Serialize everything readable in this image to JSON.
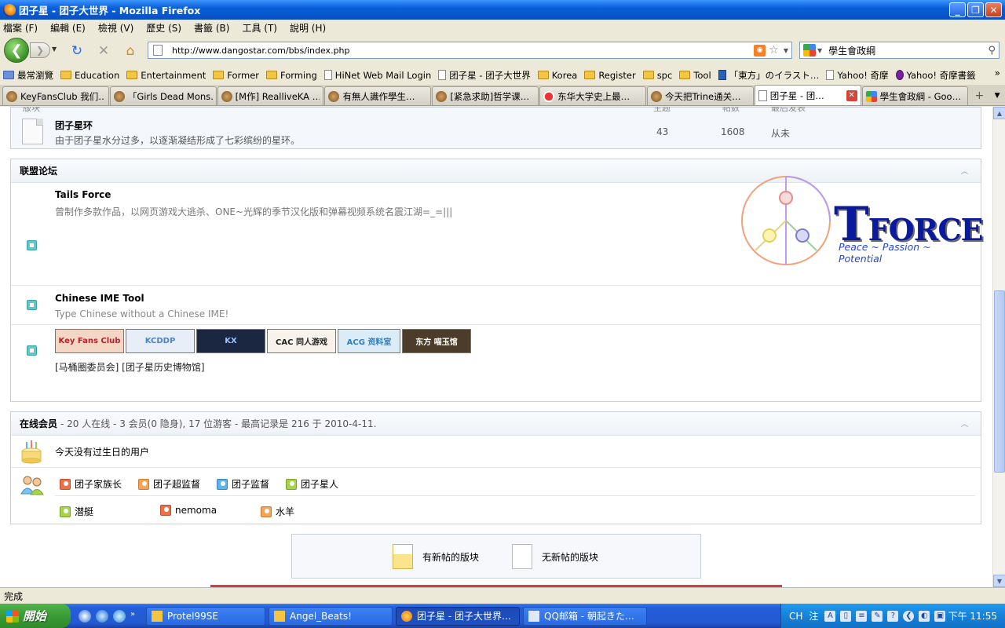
{
  "window": {
    "title": "团子星 - 团子大世界 - Mozilla Firefox",
    "buttons": {
      "minimize": "_",
      "maximize": "❐",
      "close": "✕"
    }
  },
  "menu": [
    "檔案 (F)",
    "編輯 (E)",
    "檢視 (V)",
    "歷史 (S)",
    "書籤 (B)",
    "工具 (T)",
    "說明 (H)"
  ],
  "nav": {
    "url": "http://www.dangostar.com/bbs/index.php",
    "search_value": "學生會政綱"
  },
  "bookmarks": [
    {
      "label": "最常瀏覽",
      "icon": "folder"
    },
    {
      "label": "Education",
      "icon": "folder"
    },
    {
      "label": "Entertainment",
      "icon": "folder"
    },
    {
      "label": "Former",
      "icon": "folder"
    },
    {
      "label": "Forming",
      "icon": "folder"
    },
    {
      "label": "HiNet Web Mail Login",
      "icon": "page"
    },
    {
      "label": "团子星 - 团子大世界",
      "icon": "page"
    },
    {
      "label": "Korea",
      "icon": "folder"
    },
    {
      "label": "Register",
      "icon": "folder"
    },
    {
      "label": "spc",
      "icon": "folder"
    },
    {
      "label": "Tool",
      "icon": "folder"
    },
    {
      "label": "「東方」のイラスト…",
      "icon": "pixiv"
    },
    {
      "label": "Yahoo! 奇摩",
      "icon": "page"
    },
    {
      "label": "Yahoo! 奇摩書籤",
      "icon": "yahoo"
    }
  ],
  "tabs": [
    {
      "label": "KeyFansClub 我们…",
      "icon": "avatar"
    },
    {
      "label": "「Girls Dead Mons…",
      "icon": "avatar"
    },
    {
      "label": "[M作] RealliveKA …",
      "icon": "avatar"
    },
    {
      "label": "有無人識作學生…",
      "icon": "avatar"
    },
    {
      "label": "[紧急求助]哲学课…",
      "icon": "avatar"
    },
    {
      "label": "东华大学史上最…",
      "icon": "yt"
    },
    {
      "label": "今天把Trine通关…",
      "icon": "avatar"
    },
    {
      "label": "团子星 - 团…",
      "icon": "page",
      "active": true
    },
    {
      "label": "學生會政綱 - Goo…",
      "icon": "g"
    }
  ],
  "content": {
    "top_cut": [
      "版块",
      "主题",
      "帖数",
      "最后发表"
    ],
    "forum": {
      "title": "团子星环",
      "desc": "由于团子星水分过多，以逐渐凝结形成了七彩缤纷的星环。",
      "topics": "43",
      "posts": "1608",
      "last": "从未"
    },
    "alliance": {
      "header": "联盟论坛",
      "items": [
        {
          "title": "Tails Force",
          "desc": "曾制作多款作品，以网页游戏大逃杀、ONE~光辉的季节汉化版和弹幕视频系统名震江湖=_=|||"
        },
        {
          "title": "Chinese IME Tool",
          "desc": "Type Chinese without a Chinese IME!"
        }
      ],
      "tforce_logo": {
        "word_big": "T",
        "word_rest": "FORCE",
        "tagline": "Peace ~ Passion ~ Potential"
      },
      "banners": [
        {
          "text": "Key Fans Club",
          "bg": "#f3d7c4",
          "color": "#b3222a",
          "w": 88
        },
        {
          "text": "KCDDP",
          "bg": "#e8eef8",
          "color": "#4a83c4",
          "w": 88
        },
        {
          "text": "KX",
          "bg": "#1b2740",
          "color": "#9fc3ff",
          "w": 88
        },
        {
          "text": "CAC 同人游戏",
          "bg": "#f7f2ea",
          "color": "#222",
          "w": 88
        },
        {
          "text": "ACG 资料室",
          "bg": "#dcecf7",
          "color": "#2f7fc1",
          "w": 80
        },
        {
          "text": "东方 喵玉馆",
          "bg": "#4c3c2a",
          "color": "#fff",
          "w": 88
        }
      ],
      "text_links": "[马桶圈委员会] [团子星历史博物馆]"
    },
    "online": {
      "header": "在线会员",
      "info": "- 20 人在线 - 3 会员(0 隐身), 17 位游客 - 最高记录是 216 于 2010-4-11.",
      "birthday": "今天没有过生日的用户",
      "roles": [
        {
          "label": "团子家族长",
          "color": "red"
        },
        {
          "label": "团子超监督",
          "color": "orange"
        },
        {
          "label": "团子监督",
          "color": "blue"
        },
        {
          "label": "团子星人",
          "color": "green"
        }
      ],
      "users": [
        {
          "label": "潜艇",
          "color": "green"
        },
        {
          "label": "nemoma",
          "color": "red"
        },
        {
          "label": "水羊",
          "color": "orange"
        }
      ]
    },
    "legend": {
      "new": "有新帖的版块",
      "none": "无新帖的版块"
    }
  },
  "status": "完成",
  "taskbar": {
    "start": "開始",
    "tasks": [
      {
        "label": "Protel99SE",
        "w": 152
      },
      {
        "label": "Angel_Beats!",
        "w": 158
      },
      {
        "label": "团子星 - 团子大世界…",
        "w": 158,
        "active": true
      },
      {
        "label": "QQ邮箱 - 朝起きた…",
        "w": 158
      }
    ],
    "tray_ime": "CH",
    "tray_ime2": "注",
    "clock": "下午 11:55"
  }
}
